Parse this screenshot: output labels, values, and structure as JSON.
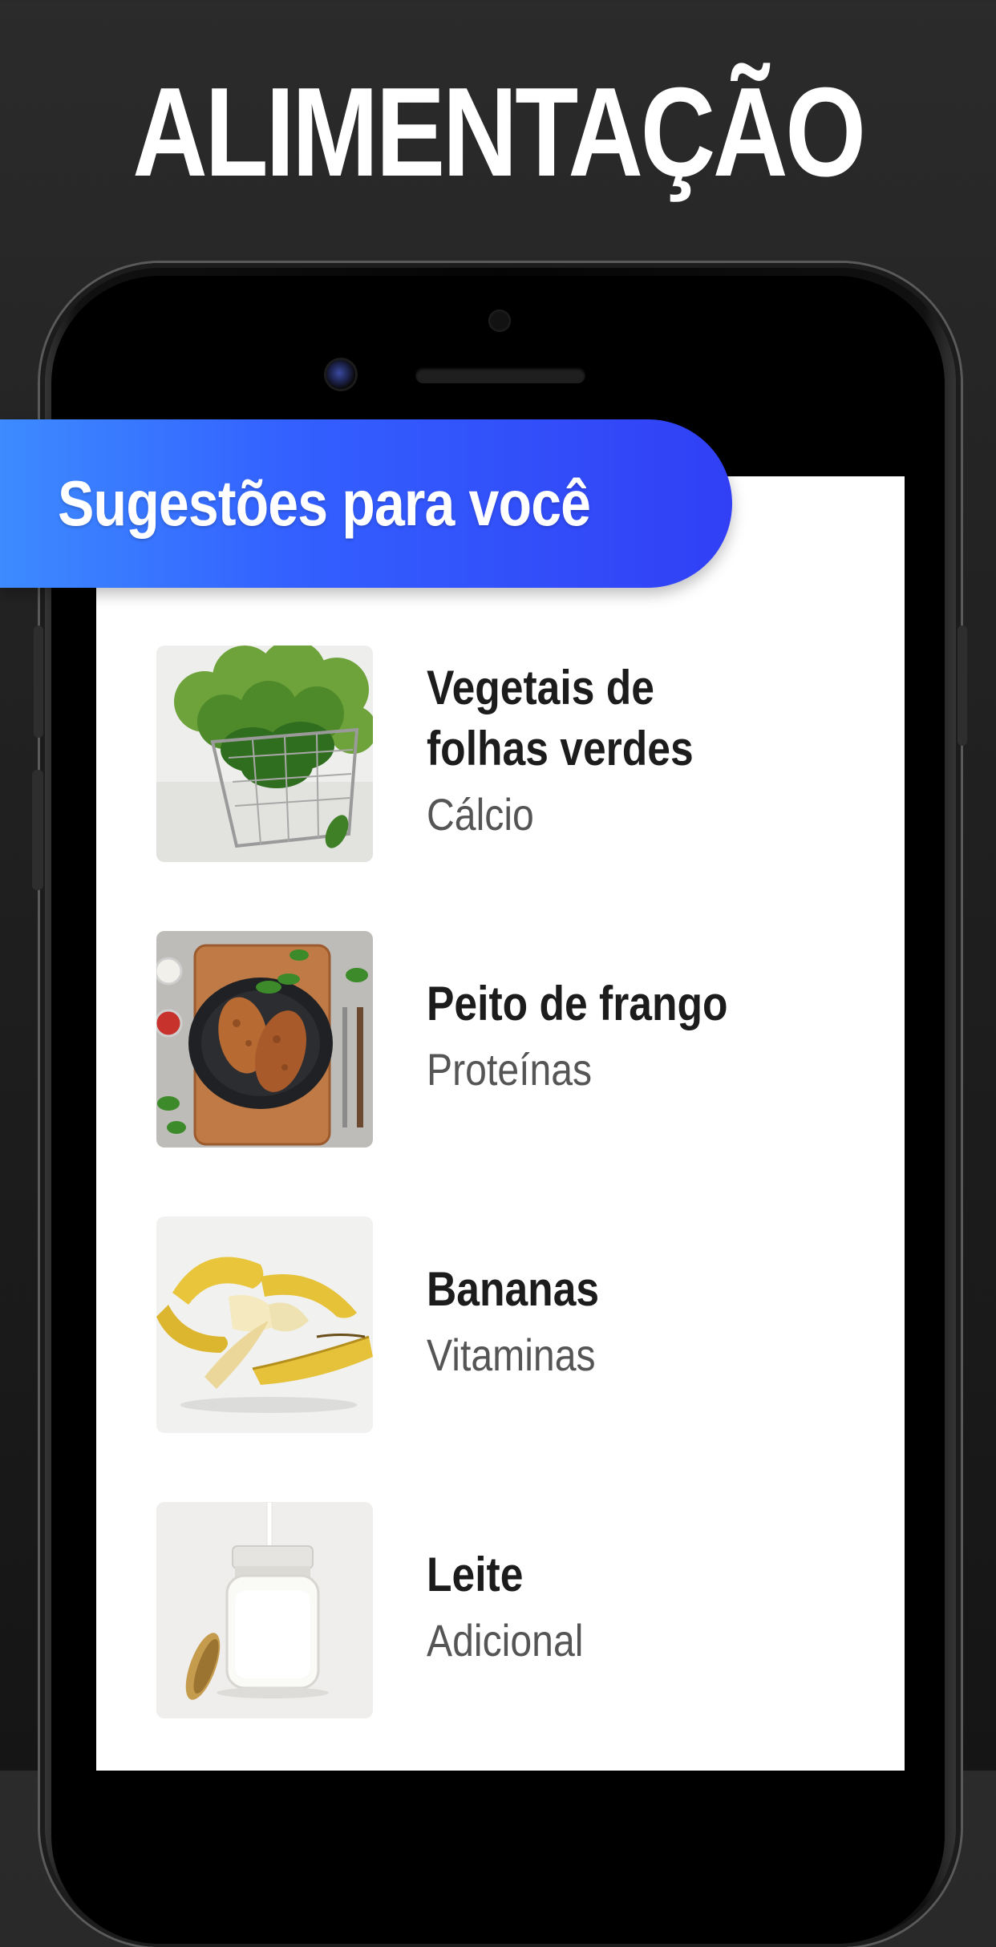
{
  "headline": "ALIMENTAÇÃO",
  "banner": {
    "title": "Sugestões para você"
  },
  "foods": [
    {
      "name_line1": "Vegetais de",
      "name_line2": "folhas verdes",
      "category": "Cálcio",
      "image_icon": "leafy-greens-photo"
    },
    {
      "name_line1": "Peito de frango",
      "name_line2": "",
      "category": "Proteínas",
      "image_icon": "chicken-breast-photo"
    },
    {
      "name_line1": "Bananas",
      "name_line2": "",
      "category": "Vitaminas",
      "image_icon": "bananas-photo"
    },
    {
      "name_line1": "Leite",
      "name_line2": "",
      "category": "Adicional",
      "image_icon": "milk-jar-photo"
    }
  ],
  "colors": {
    "background": "#222222",
    "banner_start": "#3d8bff",
    "banner_end": "#3140f5",
    "screen": "#ffffff",
    "title_text": "#1c1c1c",
    "subtitle_text": "#555555"
  }
}
